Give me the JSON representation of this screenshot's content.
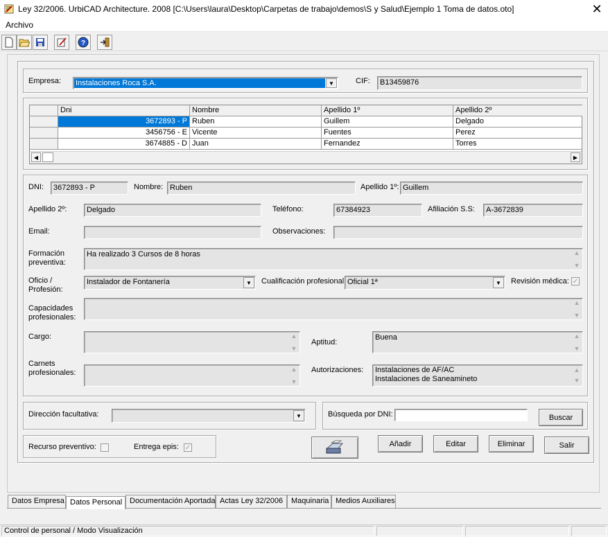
{
  "window": {
    "title": "Ley 32/2006. UrbiCAD Architecture. 2008 [C:\\Users\\laura\\Desktop\\Carpetas de trabajo\\demos\\S y Salud\\Ejemplo 1 Toma de datos.oto]",
    "close_glyph": "✕"
  },
  "menu": {
    "archivo": "Archivo"
  },
  "toolbar": {
    "buttons": [
      "new-icon",
      "open-folder-icon",
      "save-icon",
      "edit-icon",
      "help-icon",
      "exit-icon"
    ]
  },
  "empresa": {
    "label": "Empresa:",
    "value": "Instalaciones Roca S.A.",
    "cif_label": "CIF:",
    "cif_value": "B13459876"
  },
  "grid": {
    "columns": [
      "Dni",
      "Nombre",
      "Apellido 1º",
      "Apellido 2º"
    ],
    "rows": [
      {
        "dni": "3672893 - P",
        "nombre": "Ruben",
        "ap1": "Guillem",
        "ap2": "Delgado"
      },
      {
        "dni": "3456756 - E",
        "nombre": "Vicente",
        "ap1": "Fuentes",
        "ap2": "Perez"
      },
      {
        "dni": "3674885 - D",
        "nombre": "Juan",
        "ap1": "Fernandez",
        "ap2": "Torres"
      }
    ]
  },
  "persona": {
    "dni_label": "DNI:",
    "dni": "3672893 - P",
    "nombre_label": "Nombre:",
    "nombre": "Ruben",
    "ap1_label": "Apellido 1º:",
    "ap1": "Guillem",
    "ap2_label": "Apellido 2º:",
    "ap2": "Delgado",
    "telefono_label": "Teléfono:",
    "telefono": "67384923",
    "afiliacion_label": "Afiliación S.S:",
    "afiliacion": "A-3672839",
    "email_label": "Email:",
    "email": "",
    "observaciones_label": "Observaciones:",
    "observaciones": "",
    "formacion_label_1": "Formación",
    "formacion_label_2": "preventiva:",
    "formacion": "Ha realizado 3 Cursos de 8 horas",
    "oficio_label_1": "Oficio /",
    "oficio_label_2": "Profesión:",
    "oficio": "Instalador de Fontanería",
    "cualificacion_label": "Cualificación profesional:",
    "cualificacion": "Oficial 1ª",
    "revision_label": "Revisión médica:",
    "revision_checked": true,
    "capacidades_label_1": "Capacidades",
    "capacidades_label_2": "profesionales:",
    "capacidades": "",
    "cargo_label": "Cargo:",
    "cargo": "",
    "aptitud_label": "Aptitud:",
    "aptitud": "Buena",
    "carnets_label_1": "Carnets",
    "carnets_label_2": "profesionales:",
    "carnets": "",
    "autorizaciones_label": "Autorizaciones:",
    "autorizaciones_1": "Instalaciones de AF/AC",
    "autorizaciones_2": "Instalaciones de Saneamineto"
  },
  "direccion": {
    "label": "Dirección facultativa:",
    "value": ""
  },
  "busqueda": {
    "label": "Búsqueda por DNI:",
    "value": "",
    "button": "Buscar"
  },
  "recurso": {
    "label": "Recurso preventivo:",
    "checked": false
  },
  "epis": {
    "label": "Entrega epis:",
    "checked": true
  },
  "actions": {
    "anadir": "Añadir",
    "editar": "Editar",
    "eliminar": "Eliminar",
    "salir": "Salir"
  },
  "tabs": [
    "Datos Empresa",
    "Datos Personal",
    "Documentación Aportada",
    "Actas Ley 32/2006",
    "Maquinaria",
    "Medios Auxiliares"
  ],
  "active_tab": "Datos Personal",
  "status": {
    "mode": "Control de personal / Modo Visualización"
  },
  "colors": {
    "selection": "#0078d7",
    "field": "#e4e4e4"
  }
}
